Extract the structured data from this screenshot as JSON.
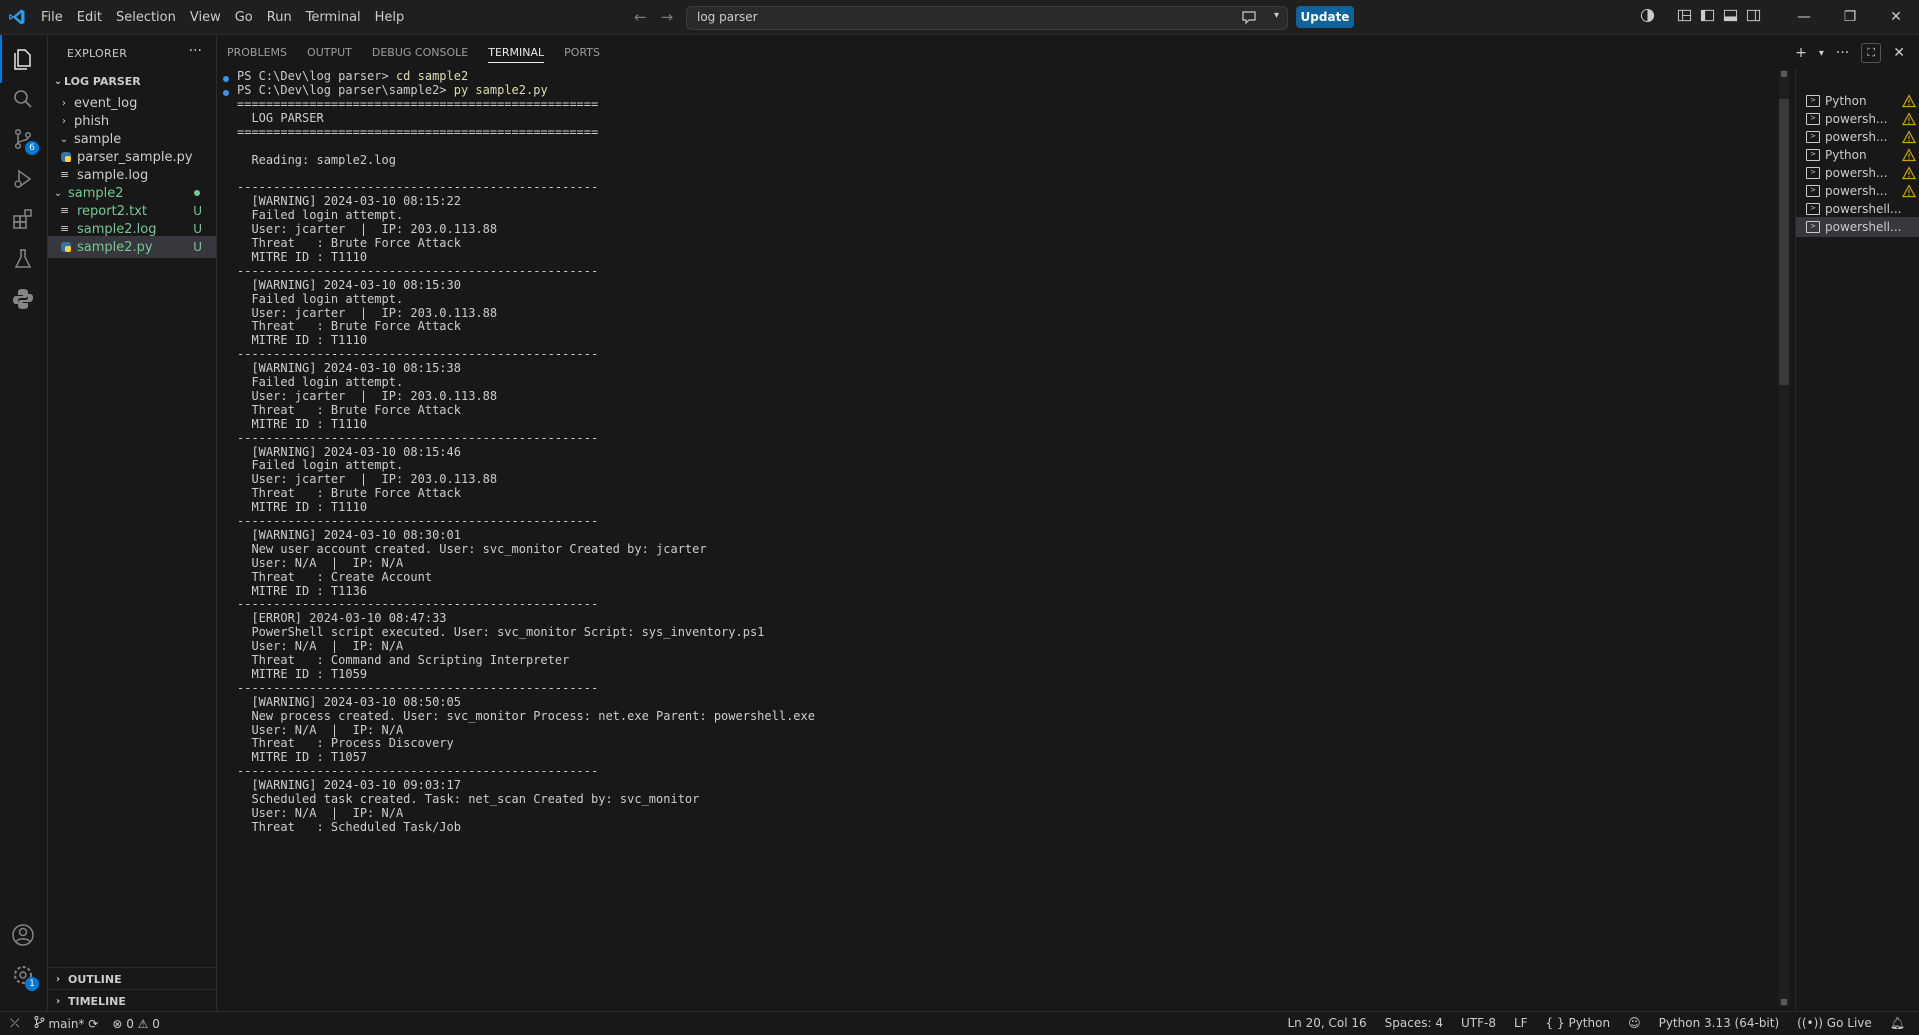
{
  "titlebar": {
    "menu": [
      "File",
      "Edit",
      "Selection",
      "View",
      "Go",
      "Run",
      "Terminal",
      "Help"
    ],
    "search_text": "log parser",
    "update_label": "Update"
  },
  "activity": {
    "source_control_badge": "6",
    "settings_badge": "1"
  },
  "sidebar": {
    "header": "EXPLORER",
    "more": "···",
    "root": "LOG PARSER",
    "items": [
      {
        "label": "event_log",
        "git": ""
      },
      {
        "label": "phish",
        "git": ""
      },
      {
        "label": "sample",
        "git": ""
      },
      {
        "label": "parser_sample.py",
        "git": ""
      },
      {
        "label": "sample.log",
        "git": ""
      },
      {
        "label": "sample2",
        "git": ""
      },
      {
        "label": "report2.txt",
        "git": "U"
      },
      {
        "label": "sample2.log",
        "git": "U"
      },
      {
        "label": "sample2.py",
        "git": "U"
      }
    ],
    "outline": "OUTLINE",
    "timeline": "TIMELINE"
  },
  "panel": {
    "tabs": [
      "PROBLEMS",
      "OUTPUT",
      "DEBUG CONSOLE",
      "TERMINAL",
      "PORTS"
    ]
  },
  "terminal": {
    "prompt1": "PS C:\\Dev\\log parser> ",
    "cmd1": "cd sample2",
    "prompt2": "PS C:\\Dev\\log parser\\sample2> ",
    "cmd2": "py sample2.py",
    "lines": [
      "==================================================",
      "  LOG PARSER",
      "==================================================",
      "",
      "  Reading: sample2.log",
      "",
      "--------------------------------------------------",
      "  [WARNING] 2024-03-10 08:15:22",
      "  Failed login attempt.",
      "  User: jcarter  |  IP: 203.0.113.88",
      "  Threat   : Brute Force Attack",
      "  MITRE ID : T1110",
      "--------------------------------------------------",
      "  [WARNING] 2024-03-10 08:15:30",
      "  Failed login attempt.",
      "  User: jcarter  |  IP: 203.0.113.88",
      "  Threat   : Brute Force Attack",
      "  MITRE ID : T1110",
      "--------------------------------------------------",
      "  [WARNING] 2024-03-10 08:15:38",
      "  Failed login attempt.",
      "  User: jcarter  |  IP: 203.0.113.88",
      "  Threat   : Brute Force Attack",
      "  MITRE ID : T1110",
      "--------------------------------------------------",
      "  [WARNING] 2024-03-10 08:15:46",
      "  Failed login attempt.",
      "  User: jcarter  |  IP: 203.0.113.88",
      "  Threat   : Brute Force Attack",
      "  MITRE ID : T1110",
      "--------------------------------------------------",
      "  [WARNING] 2024-03-10 08:30:01",
      "  New user account created. User: svc_monitor Created by: jcarter",
      "  User: N/A  |  IP: N/A",
      "  Threat   : Create Account",
      "  MITRE ID : T1136",
      "--------------------------------------------------",
      "  [ERROR] 2024-03-10 08:47:33",
      "  PowerShell script executed. User: svc_monitor Script: sys_inventory.ps1",
      "  User: N/A  |  IP: N/A",
      "  Threat   : Command and Scripting Interpreter",
      "  MITRE ID : T1059",
      "--------------------------------------------------",
      "  [WARNING] 2024-03-10 08:50:05",
      "  New process created. User: svc_monitor Process: net.exe Parent: powershell.exe",
      "  User: N/A  |  IP: N/A",
      "  Threat   : Process Discovery",
      "  MITRE ID : T1057",
      "--------------------------------------------------",
      "  [WARNING] 2024-03-10 09:03:17",
      "  Scheduled task created. Task: net_scan Created by: svc_monitor",
      "  User: N/A  |  IP: N/A",
      "  Threat   : Scheduled Task/Job"
    ]
  },
  "terminal_list": [
    {
      "label": "Python",
      "warn": true
    },
    {
      "label": "powersh...",
      "warn": true
    },
    {
      "label": "powersh...",
      "warn": true
    },
    {
      "label": "Python",
      "warn": true
    },
    {
      "label": "powersh...",
      "warn": true
    },
    {
      "label": "powersh...",
      "warn": true
    },
    {
      "label": "powershell...",
      "warn": false
    },
    {
      "label": "powershell...",
      "warn": false
    }
  ],
  "statusbar": {
    "branch": "main*",
    "errors": "0",
    "warnings": "0",
    "position": "Ln 20, Col 16",
    "spaces": "Spaces: 4",
    "encoding": "UTF-8",
    "eol": "LF",
    "language": "Python",
    "interpreter": "Python 3.13 (64-bit)",
    "golive": "Go Live"
  },
  "colors": {
    "accent": "#0078d4",
    "git_untracked": "#73c991",
    "warning": "#cca700",
    "python_blue": "#3572a5"
  }
}
